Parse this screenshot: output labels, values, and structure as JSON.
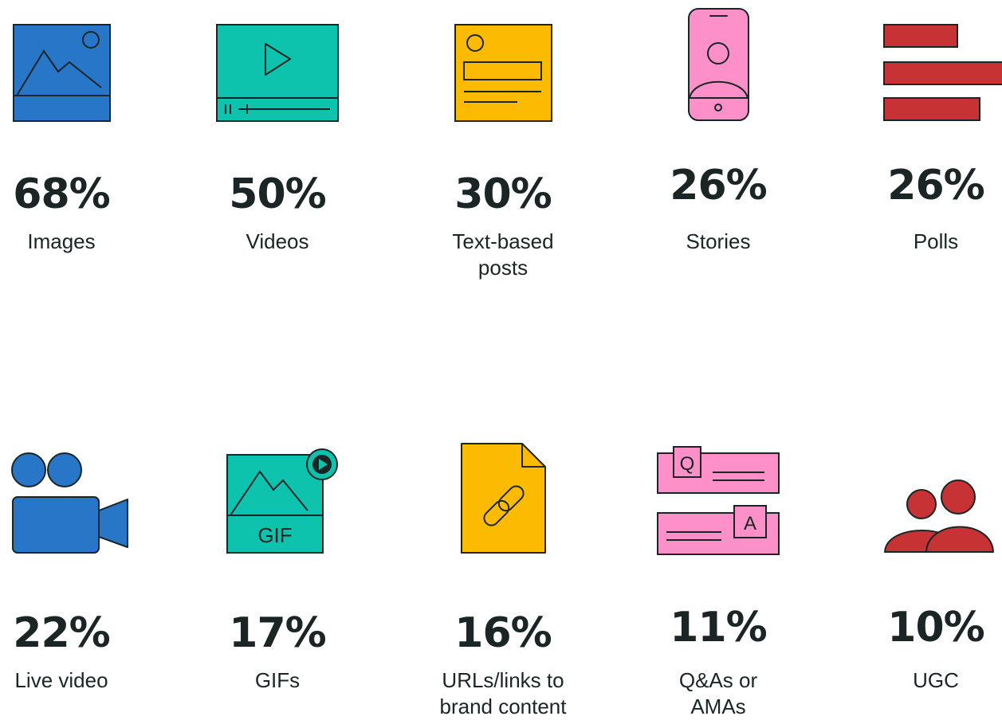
{
  "colors": {
    "blue": "#2776c7",
    "teal": "#0ec3ad",
    "yellow": "#fdbb00",
    "pink": "#fd90c9",
    "red": "#c73235",
    "ink": "#1b2526"
  },
  "stats": [
    {
      "value": "68%",
      "label": [
        "Images"
      ],
      "icon": "image-icon"
    },
    {
      "value": "50%",
      "label": [
        "Videos"
      ],
      "icon": "video-player-icon"
    },
    {
      "value": "30%",
      "label": [
        "Text-based",
        "posts"
      ],
      "icon": "text-post-icon"
    },
    {
      "value": "26%",
      "label": [
        "Stories"
      ],
      "icon": "phone-story-icon"
    },
    {
      "value": "26%",
      "label": [
        "Polls"
      ],
      "icon": "poll-bars-icon"
    },
    {
      "value": "22%",
      "label": [
        "Live video"
      ],
      "icon": "video-camera-icon"
    },
    {
      "value": "17%",
      "label": [
        "GIFs"
      ],
      "icon": "gif-icon"
    },
    {
      "value": "16%",
      "label": [
        "URLs/links to",
        "brand content"
      ],
      "icon": "link-document-icon"
    },
    {
      "value": "11%",
      "label": [
        "Q&As or",
        "AMAs"
      ],
      "icon": "qa-chat-icon"
    },
    {
      "value": "10%",
      "label": [
        "UGC"
      ],
      "icon": "users-icon"
    }
  ],
  "icon_text": {
    "gif": "GIF",
    "q": "Q",
    "a": "A"
  }
}
